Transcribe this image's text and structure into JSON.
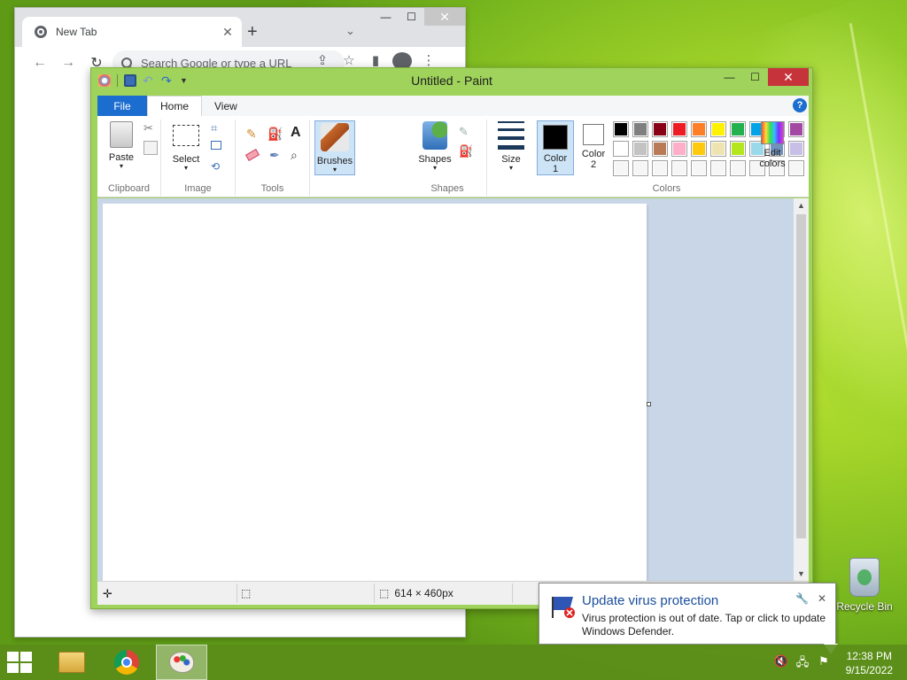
{
  "chrome": {
    "tab_title": "New Tab",
    "tab_close": "✕",
    "new_tab": "+",
    "tab_menu": "⌄",
    "omnibox_placeholder": "Search Google or type a URL",
    "win_min": "—",
    "win_max": "☐",
    "win_close": "✕"
  },
  "paint": {
    "title": "Untitled - Paint",
    "win_min": "—",
    "win_max": "☐",
    "win_close": "✕",
    "tabs": {
      "file": "File",
      "home": "Home",
      "view": "View"
    },
    "help": "?",
    "groups": {
      "clipboard": "Clipboard",
      "image": "Image",
      "tools": "Tools",
      "shapes": "Shapes",
      "colors": "Colors"
    },
    "buttons": {
      "paste": "Paste",
      "select": "Select",
      "brushes": "Brushes",
      "shapes": "Shapes",
      "size": "Size",
      "color1_line1": "Color",
      "color1_line2": "1",
      "color2_line1": "Color",
      "color2_line2": "2",
      "edit_colors_line1": "Edit",
      "edit_colors_line2": "colors"
    },
    "palette_row1": [
      "#000000",
      "#7f7f7f",
      "#880015",
      "#ed1c24",
      "#ff7f27",
      "#fff200",
      "#22b14c",
      "#00a2e8",
      "#3f48cc",
      "#a349a4"
    ],
    "palette_row2": [
      "#ffffff",
      "#c3c3c3",
      "#b97a57",
      "#ffaec9",
      "#ffc90e",
      "#efe4b0",
      "#b5e61d",
      "#99d9ea",
      "#7092be",
      "#c8bfe7"
    ],
    "color1": "#000000",
    "color2": "#ffffff",
    "status": {
      "dimensions": "614 × 460px"
    }
  },
  "notification": {
    "title": "Update virus protection",
    "body": "Virus protection is out of date. Tap or click to update Windows Defender."
  },
  "desktop": {
    "recycle_bin": "Recycle Bin"
  },
  "taskbar": {
    "time": "12:38 PM",
    "date": "9/15/2022"
  }
}
